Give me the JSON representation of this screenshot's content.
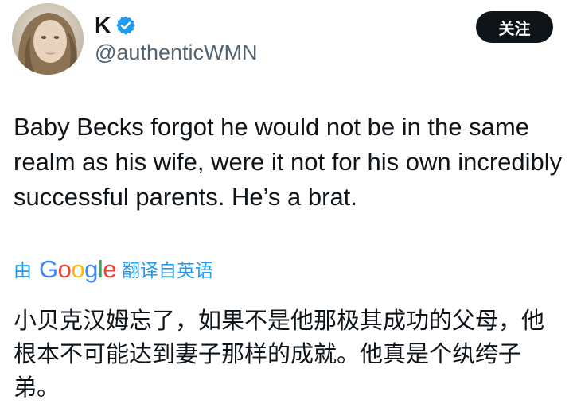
{
  "author": {
    "display_name": "K",
    "handle": "@authenticWMN",
    "verified": true,
    "avatar_icon": "profile-photo"
  },
  "follow_button": {
    "label": "关注"
  },
  "tweet": {
    "text": "Baby Becks forgot he would not be in the same realm as his wife, were it not for his own incredibly successful parents. He’s a brat."
  },
  "translation": {
    "prefix": "由",
    "provider": "Google",
    "suffix": "翻译自英语",
    "text": "小贝克汉姆忘了，如果不是他那极其成功的父母，他根本不可能达到妻子那样的成就。他真是个纨绔子弟。"
  },
  "colors": {
    "text_primary": "#0f1419",
    "text_secondary": "#536471",
    "accent_blue": "#1d9bf0",
    "button_bg": "#0f1419",
    "button_text": "#ffffff",
    "google_blue": "#4285f4",
    "google_red": "#ea4335",
    "google_yellow": "#fbbc05",
    "google_green": "#34a853"
  }
}
